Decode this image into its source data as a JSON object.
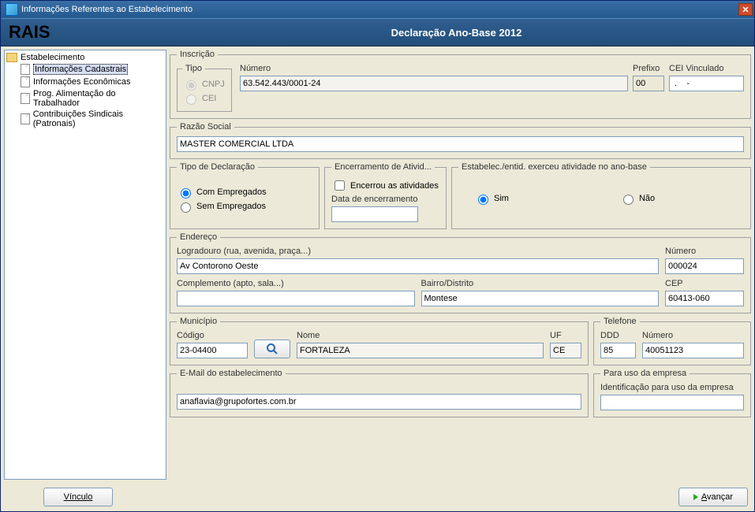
{
  "window": {
    "title": "Informações Referentes ao Estabelecimento"
  },
  "banner": {
    "brand": "RAIS",
    "subtitle": "Declaração Ano-Base 2012"
  },
  "tree": {
    "root": "Estabelecimento",
    "items": [
      {
        "label": "Informações Cadastrais",
        "selected": true
      },
      {
        "label": "Informações Econômicas",
        "selected": false
      },
      {
        "label": "Prog. Alimentação do Trabalhador",
        "selected": false
      },
      {
        "label": "Contribuições Sindicais (Patronais)",
        "selected": false
      }
    ]
  },
  "inscricao": {
    "legend": "Inscrição",
    "tipo_legend": "Tipo",
    "tipo_cnpj": "CNPJ",
    "tipo_cei": "CEI",
    "numero_label": "Número",
    "numero_value": "63.542.443/0001-24",
    "prefixo_label": "Prefixo",
    "prefixo_value": "00",
    "cei_vinc_label": "CEI Vinculado",
    "cei_vinc_value": " .    -"
  },
  "razao": {
    "legend": "Razão Social",
    "value": "MASTER COMERCIAL LTDA"
  },
  "tipo_declaracao": {
    "legend": "Tipo de Declaração",
    "com": "Com Empregados",
    "sem": "Sem Empregados"
  },
  "encerramento": {
    "legend": "Encerramento de Ativid...",
    "check_label": "Encerrou as atividades",
    "data_label": "Data de encerramento",
    "data_value": ""
  },
  "exerceu": {
    "legend": "Estabelec./entid. exerceu atividade no ano-base",
    "sim": "Sim",
    "nao": "Não"
  },
  "endereco": {
    "legend": "Endereço",
    "logradouro_label": "Logradouro (rua, avenida, praça...)",
    "logradouro_value": "Av Contorono Oeste",
    "numero_label": "Número",
    "numero_value": "000024",
    "complemento_label": "Complemento (apto, sala...)",
    "complemento_value": "",
    "bairro_label": "Bairro/Distrito",
    "bairro_value": "Montese",
    "cep_label": "CEP",
    "cep_value": "60413-060"
  },
  "municipio": {
    "legend": "Município",
    "codigo_label": "Código",
    "codigo_value": "23-04400",
    "nome_label": "Nome",
    "nome_value": "FORTALEZA",
    "uf_label": "UF",
    "uf_value": "CE"
  },
  "telefone": {
    "legend": "Telefone",
    "ddd_label": "DDD",
    "ddd_value": "85",
    "numero_label": "Número",
    "numero_value": "40051123"
  },
  "email": {
    "legend": "E-Mail do estabelecimento",
    "value": "anaflavia@grupofortes.com.br"
  },
  "uso_empresa": {
    "legend": "Para uso da empresa",
    "label": "Identificação para uso da empresa",
    "value": ""
  },
  "footer": {
    "vinculo": "Vínculo",
    "avancar_prefix": "A",
    "avancar_rest": "vançar"
  }
}
